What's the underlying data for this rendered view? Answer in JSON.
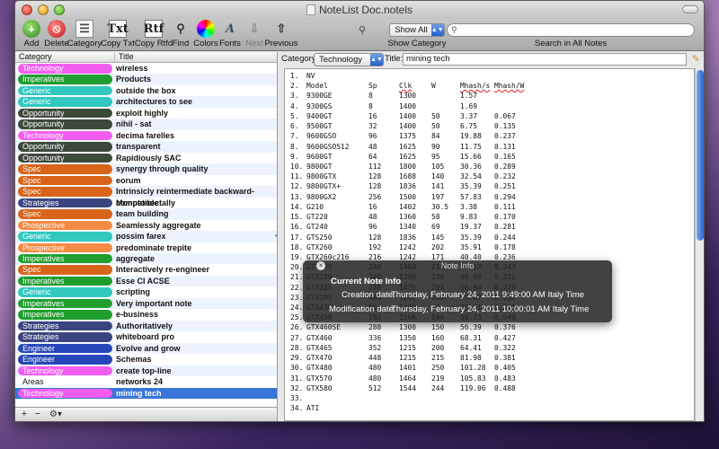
{
  "window": {
    "title": "NoteList Doc.notels"
  },
  "toolbar": {
    "buttons": [
      {
        "label": "Add",
        "icon": "add-icon"
      },
      {
        "label": "Delete",
        "icon": "delete-icon"
      },
      {
        "label": "Category",
        "icon": "category-icon"
      },
      {
        "label": "Copy Txt",
        "icon": "copy-txt-icon"
      },
      {
        "label": "Copy Rtfd",
        "icon": "copy-rtfd-icon"
      },
      {
        "label": "Find",
        "icon": "magnifier-icon"
      },
      {
        "label": "Colors",
        "icon": "color-wheel-icon"
      },
      {
        "label": "Fonts",
        "icon": "fonts-icon"
      },
      {
        "label": "Next",
        "icon": "next-icon"
      },
      {
        "label": "Previous",
        "icon": "previous-icon"
      }
    ],
    "show_category": {
      "value": "Show All",
      "label": "Show Category"
    },
    "search": {
      "value": "",
      "label": "Search in All Notes"
    }
  },
  "list": {
    "columns": {
      "category": "Category",
      "title": "Title"
    },
    "rows": [
      {
        "category": "Technology",
        "title": "wireless",
        "color": "#f25df0"
      },
      {
        "category": "Imperatives",
        "title": "Products",
        "color": "#1f9e2e"
      },
      {
        "category": "Generic",
        "title": "outside the box",
        "color": "#32c8c0"
      },
      {
        "category": "Generic",
        "title": "architectures to see",
        "color": "#32c8c0"
      },
      {
        "category": "Opportunity",
        "title": "exploit highly",
        "color": "#3c4a3a"
      },
      {
        "category": "Opportunity",
        "title": "nihil - sat",
        "color": "#3c4a3a"
      },
      {
        "category": "Technology",
        "title": "decima farelles",
        "color": "#f25df0"
      },
      {
        "category": "Opportunity",
        "title": "transparent",
        "color": "#3c4a3a"
      },
      {
        "category": "Opportunity",
        "title": "Rapidiously SAC",
        "color": "#3c4a3a"
      },
      {
        "category": "Spec",
        "title": "synergy through quality",
        "color": "#d8641a"
      },
      {
        "category": "Spec",
        "title": "eorum",
        "color": "#d8641a"
      },
      {
        "category": "Spec",
        "title": "Intrinsicly reintermediate backward-compatible",
        "color": "#d8641a"
      },
      {
        "category": "Strategies",
        "title": "Monotonectally",
        "color": "#3a4580"
      },
      {
        "category": "Spec",
        "title": "team building",
        "color": "#d8641a"
      },
      {
        "category": "Prospective",
        "title": "Seamlessly aggregate",
        "color": "#f58a44"
      },
      {
        "category": "Generic",
        "title": "possim farex",
        "color": "#32c8c0"
      },
      {
        "category": "Prospective",
        "title": "predominate trepite",
        "color": "#f58a44"
      },
      {
        "category": "Imperatives",
        "title": "aggregate",
        "color": "#1f9e2e"
      },
      {
        "category": "Spec",
        "title": "Interactively re-engineer",
        "color": "#d8641a"
      },
      {
        "category": "Imperatives",
        "title": "Esse CI ACSE",
        "color": "#1f9e2e"
      },
      {
        "category": "Generic",
        "title": "scripting",
        "color": "#32c8c0"
      },
      {
        "category": "Imperatives",
        "title": "Very important note",
        "color": "#1f9e2e"
      },
      {
        "category": "Imperatives",
        "title": "e-business",
        "color": "#1f9e2e"
      },
      {
        "category": "Strategies",
        "title": "Authoritatively",
        "color": "#3a4580"
      },
      {
        "category": "Strategies",
        "title": "whiteboard pro",
        "color": "#3a4580"
      },
      {
        "category": "Engineer",
        "title": "Evolve and grow",
        "color": "#2446b8"
      },
      {
        "category": "Engineer",
        "title": "Schemas",
        "color": "#2446b8"
      },
      {
        "category": "Technology",
        "title": "create top-line",
        "color": "#f25df0"
      },
      {
        "category": "Areas",
        "title": "networks 24",
        "color": ""
      },
      {
        "category": "Technology",
        "title": "mining tech",
        "color": "#f25df0",
        "selected": true
      }
    ]
  },
  "editor": {
    "category_label": "Category:",
    "category_value": "Technology",
    "title_label": "Title:",
    "title_value": "mining tech",
    "lines": [
      [
        "1.",
        "NV",
        "",
        "",
        "",
        "",
        ""
      ],
      [
        "2.",
        "Model",
        "Sp",
        "Clk",
        "W",
        "Mhash/s",
        "Mhash/W"
      ],
      [
        "3.",
        "9300GE",
        "8",
        "1300",
        "",
        "1.57",
        ""
      ],
      [
        "4.",
        "9300GS",
        "8",
        "1400",
        "",
        "1.69",
        ""
      ],
      [
        "5.",
        "9400GT",
        "16",
        "1400",
        "50",
        "3.37",
        "0.067"
      ],
      [
        "6.",
        "9500GT",
        "32",
        "1400",
        "50",
        "6.75",
        "0.135"
      ],
      [
        "7.",
        "9600GSO",
        "96",
        "1375",
        "84",
        "19.88",
        "0.237"
      ],
      [
        "8.",
        "9600GSO512",
        "48",
        "1625",
        "90",
        "11.75",
        "0.131"
      ],
      [
        "9.",
        "9600GT",
        "64",
        "1625",
        "95",
        "15.66",
        "0.165"
      ],
      [
        "10.",
        "9800GT",
        "112",
        "1800",
        "105",
        "30.36",
        "0.289"
      ],
      [
        "11.",
        "9800GTX",
        "128",
        "1688",
        "140",
        "32.54",
        "0.232"
      ],
      [
        "12.",
        "9800GTX+",
        "128",
        "1836",
        "141",
        "35.39",
        "0.251"
      ],
      [
        "13.",
        "9800GX2",
        "256",
        "1500",
        "197",
        "57.83",
        "0.294"
      ],
      [
        "14.",
        "G210",
        "16",
        "1402",
        "30.5",
        "3.38",
        "0.111"
      ],
      [
        "15.",
        "GT220",
        "48",
        "1360",
        "58",
        "9.83",
        "0.170"
      ],
      [
        "16.",
        "GT240",
        "96",
        "1340",
        "69",
        "19.37",
        "0.281"
      ],
      [
        "17.",
        "GTS250",
        "128",
        "1836",
        "145",
        "35.39",
        "0.244"
      ],
      [
        "18.",
        "GTX260",
        "192",
        "1242",
        "202",
        "35.91",
        "0.178"
      ],
      [
        "19.",
        "GTX260c216",
        "216",
        "1242",
        "171",
        "40.40",
        "0.236"
      ],
      [
        "20.",
        "GTX275",
        "240",
        "1404",
        "219",
        "54.17",
        "0.247"
      ],
      [
        "21.",
        "GTX280",
        "240",
        "1296",
        "236",
        "50.00",
        "0.212"
      ],
      [
        "22.",
        "GTX285",
        "240",
        "1476",
        "204",
        "56.94",
        "0.279"
      ],
      [
        "23.",
        "GTX295",
        "480",
        "1242",
        "289",
        "95.82",
        "0.332"
      ],
      [
        "24.",
        "GTX430",
        "96",
        "1400",
        "49",
        "25.91",
        "0.529"
      ],
      [
        "25.",
        "GTX450",
        "192",
        "1566",
        "106",
        "58.23",
        "0.549"
      ],
      [
        "26.",
        "GTX460SE",
        "288",
        "1300",
        "150",
        "56.39",
        "0.376"
      ],
      [
        "27.",
        "GTX460",
        "336",
        "1350",
        "160",
        "68.31",
        "0.427"
      ],
      [
        "28.",
        "GTX465",
        "352",
        "1215",
        "200",
        "64.41",
        "0.322"
      ],
      [
        "29.",
        "GTX470",
        "448",
        "1215",
        "215",
        "81.98",
        "0.381"
      ],
      [
        "30.",
        "GTX480",
        "480",
        "1401",
        "250",
        "101.28",
        "0.405"
      ],
      [
        "31.",
        "GTX570",
        "480",
        "1464",
        "219",
        "105.83",
        "0.483"
      ],
      [
        "32.",
        "GTX580",
        "512",
        "1544",
        "244",
        "119.06",
        "0.488"
      ],
      [
        "33.",
        "",
        "",
        "",
        "",
        "",
        ""
      ],
      [
        "34.",
        "ATI",
        "",
        "",
        "",
        "",
        ""
      ]
    ]
  },
  "note_info": {
    "title": "Note Info",
    "heading": "Current Note Info",
    "creation_label": "Creation date:",
    "creation_value": "Thursday, February 24, 2011 9:49:00 AM Italy Time",
    "modification_label": "Modification date:",
    "modification_value": "Thursday, February 24, 2011 10:00:01 AM Italy Time"
  }
}
